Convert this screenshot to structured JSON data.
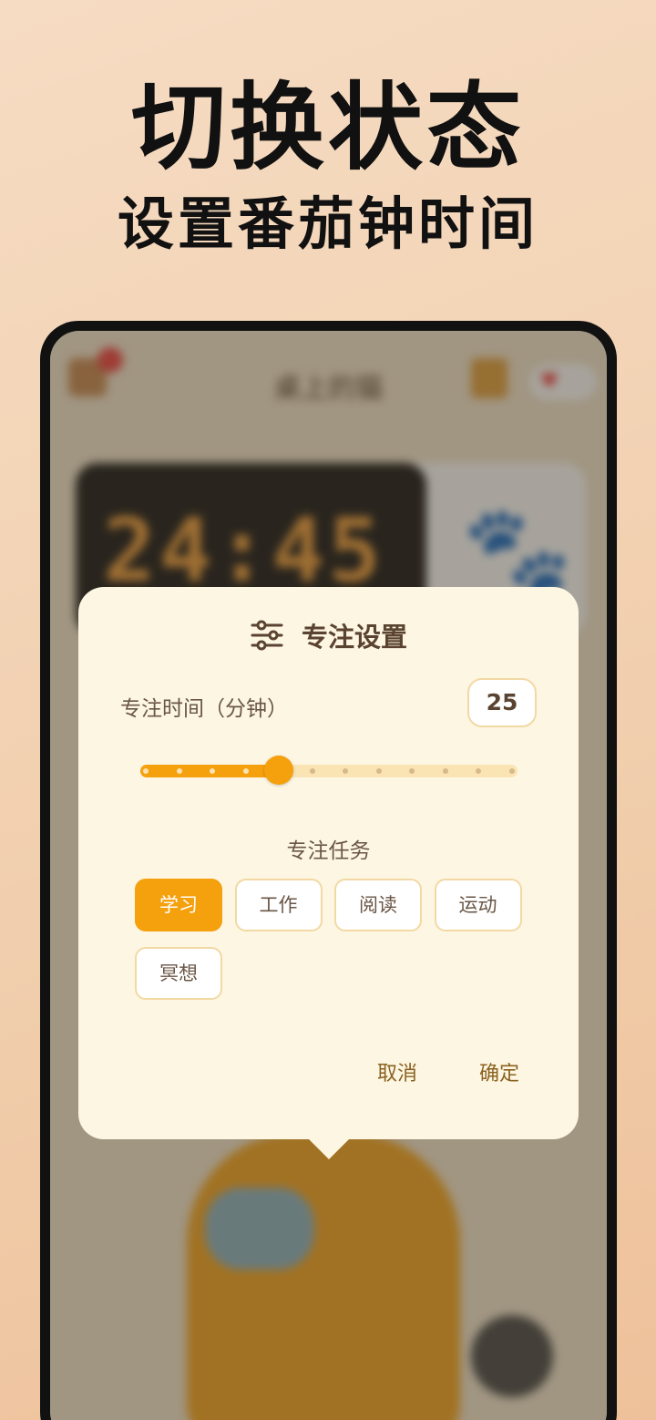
{
  "headline": {
    "line1": "切换状态",
    "line2": "设置番茄钟时间"
  },
  "background_app": {
    "title": "桌上的猫",
    "timer": "24:45"
  },
  "dialog": {
    "title": "专注设置",
    "duration_label": "专注时间（分钟）",
    "duration_value": "25",
    "slider": {
      "value_fraction": 0.364,
      "tick_count": 12
    },
    "task_label": "专注任务",
    "tasks": [
      "学习",
      "工作",
      "阅读",
      "运动",
      "冥想"
    ],
    "selected_task": "学习",
    "cancel": "取消",
    "confirm": "确定"
  },
  "colors": {
    "accent": "#f5a00d",
    "track": "#fbe4b4",
    "dialog_bg": "#fdf6e2",
    "text": "#5a4330"
  }
}
